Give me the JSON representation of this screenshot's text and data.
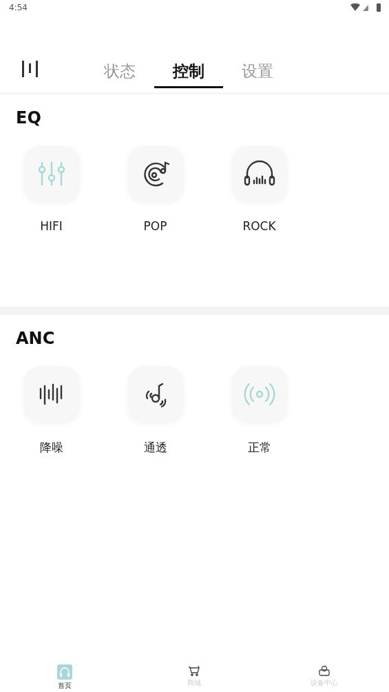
{
  "status_bar": {
    "time": "4:54"
  },
  "tabs": [
    {
      "label": "状态",
      "selected": false
    },
    {
      "label": "控制",
      "selected": true
    },
    {
      "label": "设置",
      "selected": false
    }
  ],
  "sections": [
    {
      "title": "EQ",
      "items": [
        {
          "label": "HIFI",
          "kind": "sliders",
          "selected": true
        },
        {
          "label": "POP",
          "kind": "record",
          "selected": false
        },
        {
          "label": "ROCK",
          "kind": "headphones",
          "selected": false
        }
      ]
    },
    {
      "title": "ANC",
      "items": [
        {
          "label": "降噪",
          "kind": "wave",
          "selected": false
        },
        {
          "label": "通透",
          "kind": "note",
          "selected": false
        },
        {
          "label": "正常",
          "kind": "signal",
          "selected": true
        }
      ]
    }
  ],
  "bottom_nav": [
    {
      "label": "首页",
      "kind": "home",
      "selected": true
    },
    {
      "label": "商城",
      "kind": "cart",
      "selected": false
    },
    {
      "label": "设备中心",
      "kind": "device",
      "selected": false
    }
  ]
}
